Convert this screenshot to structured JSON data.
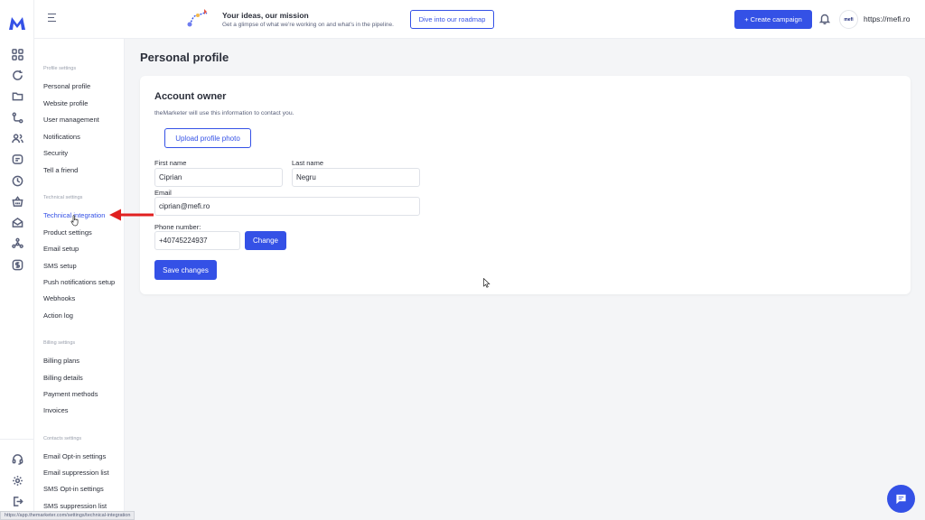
{
  "colors": {
    "accent": "#3451e6",
    "annotation": "#e02020",
    "text": "#2b2f3a",
    "muted": "#59607a"
  },
  "rail": {
    "icons": [
      "grid-icon",
      "refresh-icon",
      "folder-icon",
      "flow-icon",
      "users-icon",
      "chat-icon",
      "clock-icon",
      "basket-icon",
      "mail-icon",
      "network-icon",
      "dollar-icon"
    ],
    "bottom_icons": [
      "headset-icon",
      "gear-icon",
      "logout-icon"
    ]
  },
  "topbar": {
    "promo_title": "Your ideas, our mission",
    "promo_subtitle": "Get a glimpse of what we’re working on and what’s in the pipeline.",
    "roadmap_button": "Dive into our roadmap",
    "create_button": "+ Create campaign",
    "avatar_text": "mefi",
    "site_url": "https://mefi.ro"
  },
  "sidebar": {
    "profile_section": "Profile settings",
    "profile_items": [
      "Personal profile",
      "Website profile",
      "User management",
      "Notifications",
      "Security",
      "Tell a friend"
    ],
    "technical_section": "Technical settings",
    "technical_items": [
      "Technical integration",
      "Product settings",
      "Email setup",
      "SMS setup",
      "Push notifications setup",
      "Webhooks",
      "Action log"
    ],
    "billing_section": "Billing settings",
    "billing_items": [
      "Billing plans",
      "Billing details",
      "Payment methods",
      "Invoices"
    ],
    "contacts_section": "Contacts settings",
    "contacts_items": [
      "Email Opt-in settings",
      "Email suppression list",
      "SMS Opt-in settings",
      "SMS suppression list"
    ],
    "active_item": "Technical integration"
  },
  "main": {
    "page_title": "Personal profile",
    "card_title": "Account owner",
    "card_subtitle": "theMarketer will use this information to contact you.",
    "upload_button": "Upload profile photo",
    "first_name_label": "First name",
    "first_name_value": "Ciprian",
    "last_name_label": "Last name",
    "last_name_value": "Negru",
    "email_label": "Email",
    "email_value": "ciprian@mefi.ro",
    "phone_label": "Phone number:",
    "phone_value": "+40745224937",
    "change_button": "Change",
    "save_button": "Save changes"
  },
  "statusbar_url": "https://app.themarketer.com/settings/technical-integration"
}
